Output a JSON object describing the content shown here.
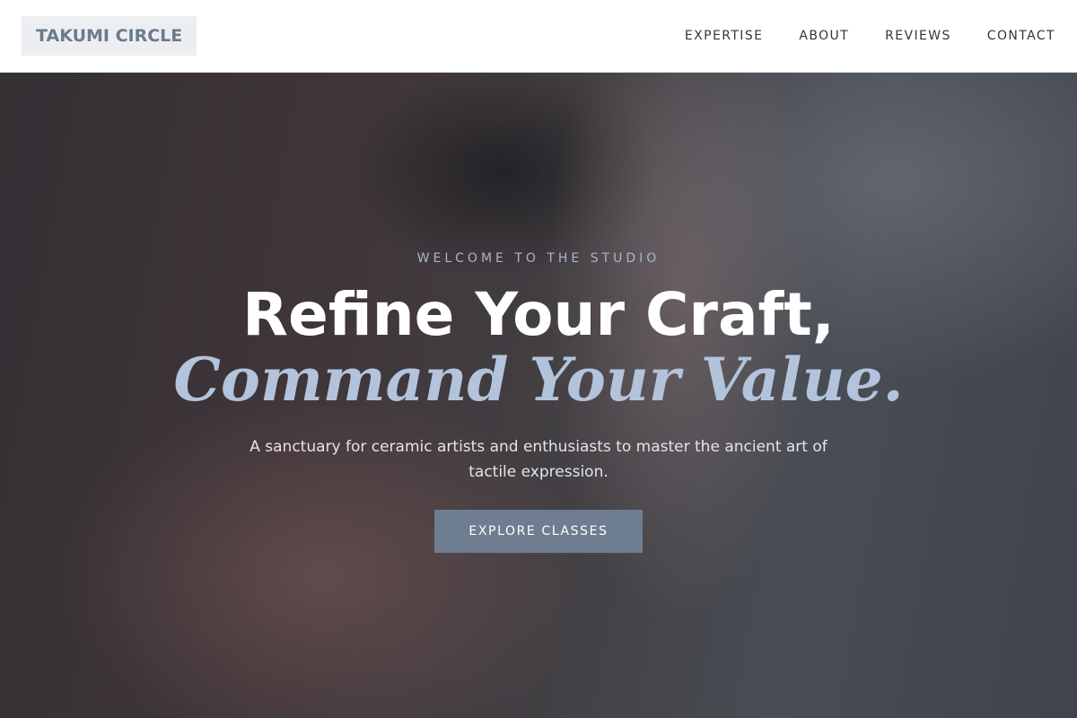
{
  "header": {
    "logo": "TAKUMI CIRCLE",
    "nav": [
      {
        "label": "EXPERTISE"
      },
      {
        "label": "ABOUT"
      },
      {
        "label": "REVIEWS"
      },
      {
        "label": "CONTACT"
      }
    ]
  },
  "hero": {
    "eyebrow": "WELCOME TO THE STUDIO",
    "headline_line1": "Refine Your Craft,",
    "headline_line2": "Command Your Value.",
    "subtitle": "A sanctuary for ceramic artists and enthusiasts to master the ancient art of tactile expression.",
    "cta_label": "EXPLORE CLASSES"
  },
  "colors": {
    "accent": "#6f7d91",
    "headline_accent": "#b3c3dc",
    "logo_text": "#6a7a8f"
  }
}
